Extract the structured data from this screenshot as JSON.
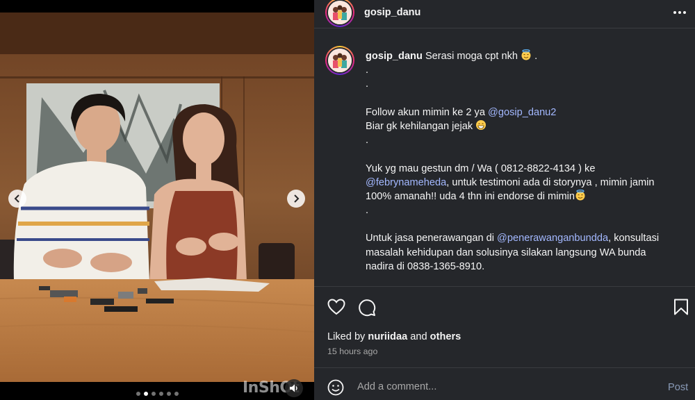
{
  "post": {
    "username": "gosip_danu",
    "media": {
      "watermark": "InShOt",
      "slide_count": 6,
      "active_slide": 1
    }
  },
  "caption": {
    "username": "gosip_danu",
    "first_text": "Serasi moga cpt nkh",
    "lines": [
      {
        "segments": [
          {
            "text": "."
          }
        ]
      },
      {
        "segments": [
          {
            "text": "."
          }
        ]
      },
      {
        "segments": []
      },
      {
        "segments": [
          {
            "text": "Follow akun mimin ke 2 ya "
          },
          {
            "text": "@gosip_danu2",
            "mention": true
          }
        ]
      },
      {
        "segments": [
          {
            "text": "Biar gk kehilangan jejak "
          }
        ],
        "emoji": "grin"
      },
      {
        "segments": [
          {
            "text": "."
          }
        ]
      },
      {
        "segments": []
      },
      {
        "segments": [
          {
            "text": "Yuk yg mau gestun dm / Wa ( 0812-8822-4134 ) ke"
          }
        ]
      },
      {
        "segments": [
          {
            "text": "@febrynameheda",
            "mention": true
          },
          {
            "text": ", untuk testimoni ada di storynya , mimin jamin"
          }
        ]
      },
      {
        "segments": [
          {
            "text": "100% amanah!! uda 4 thn ini endorse di mimin"
          }
        ],
        "emoji": "halo"
      },
      {
        "segments": [
          {
            "text": "."
          }
        ]
      },
      {
        "segments": []
      },
      {
        "segments": [
          {
            "text": "Untuk jasa penerawangan di "
          },
          {
            "text": "@penerawanganbundda",
            "mention": true
          },
          {
            "text": ", konsultasi"
          }
        ]
      },
      {
        "segments": [
          {
            "text": "masalah kehidupan dan solusinya silakan langsung WA bunda"
          }
        ]
      },
      {
        "segments": [
          {
            "text": "nadira di 0838-1365-8910."
          }
        ]
      }
    ]
  },
  "liked_by": {
    "prefix": "Liked by",
    "user": "nuriidaa",
    "middle": "and",
    "others": "others"
  },
  "timestamp": "15 hours ago",
  "comment": {
    "placeholder": "Add a comment...",
    "post_label": "Post"
  },
  "icons": {
    "more": "more-horizontal-icon",
    "like": "heart-icon",
    "comment": "comment-icon",
    "save": "bookmark-icon",
    "emoji": "emoji-smiley-icon",
    "prev": "chevron-left-icon",
    "next": "chevron-right-icon",
    "sound": "sound-icon"
  },
  "colors": {
    "panel_bg": "#25272b",
    "mention": "#a3b8ff",
    "post_button": "#8a9bb8",
    "muted_text": "#a8a8a8"
  }
}
